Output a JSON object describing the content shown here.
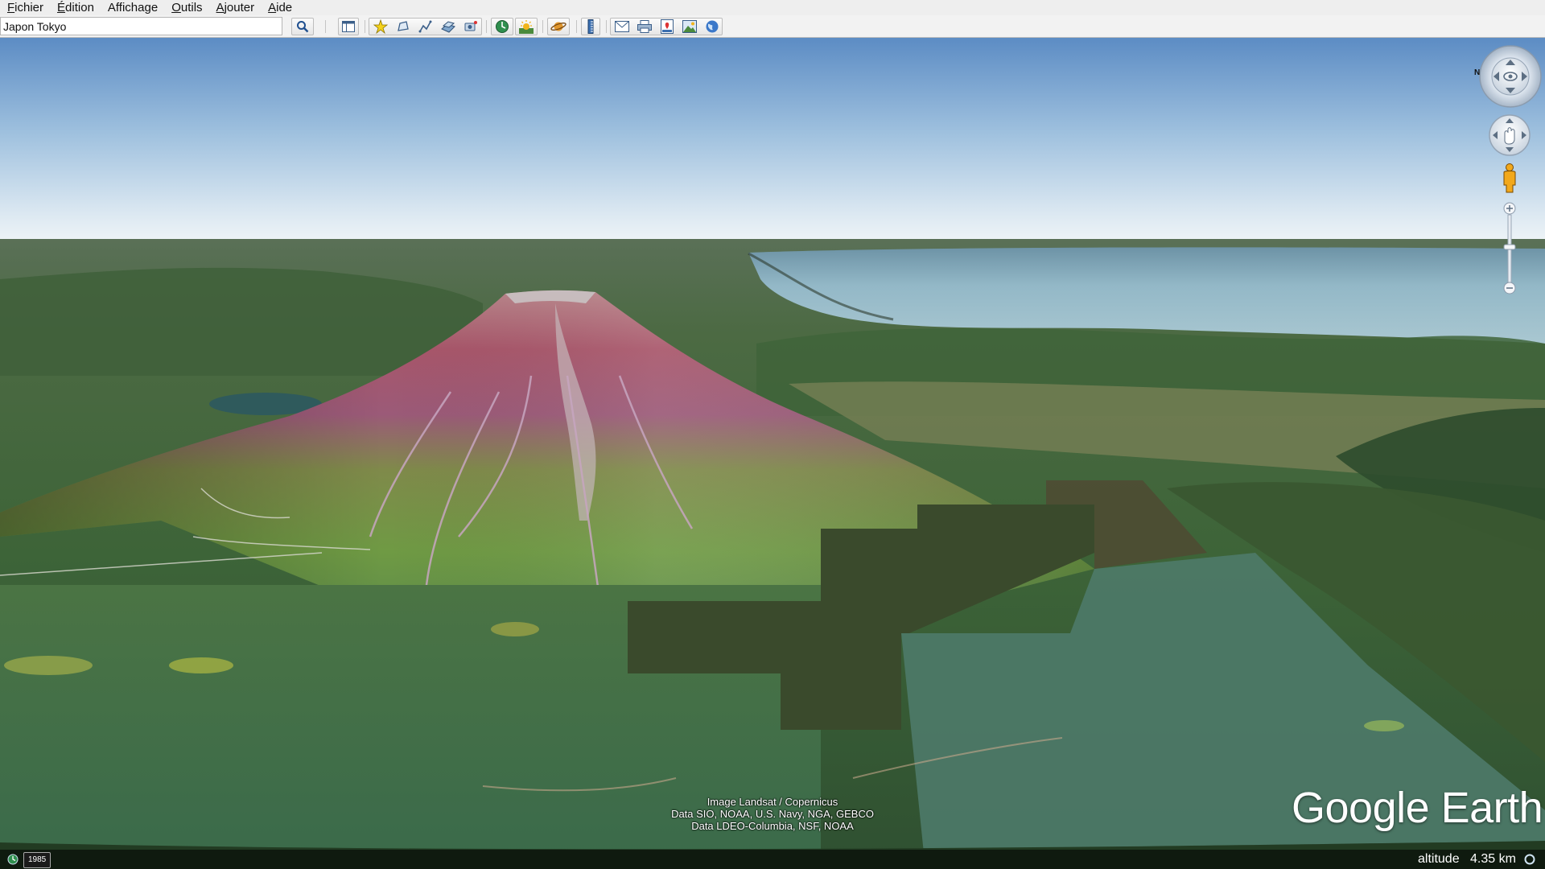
{
  "menubar": {
    "items": [
      {
        "mnemonic": "F",
        "rest": "ichier"
      },
      {
        "mnemonic": "É",
        "rest": "dition"
      },
      {
        "mnemonic": "",
        "rest": "Affichage"
      },
      {
        "mnemonic": "O",
        "rest": "utils"
      },
      {
        "mnemonic": "A",
        "rest": "jouter"
      },
      {
        "mnemonic": "A",
        "rest": "ide"
      }
    ]
  },
  "search": {
    "value": "Japon Tokyo"
  },
  "toolbar": {
    "icons": [
      "search-icon",
      "sidebar-toggle-icon",
      "placemark-icon",
      "polygon-icon",
      "path-icon",
      "image-overlay-icon",
      "record-tour-icon",
      "historical-imagery-icon",
      "sunlight-icon",
      "planets-icon",
      "ruler-icon",
      "email-icon",
      "print-icon",
      "save-image-icon",
      "view-in-maps-icon",
      "earth-gallery-icon"
    ]
  },
  "view": {
    "attribution": [
      "Image Landsat / Copernicus",
      "Data SIO, NOAA, U.S. Navy, NGA, GEBCO",
      "Data LDEO-Columbia, NSF, NOAA"
    ],
    "logo": "Google Earth",
    "year_badge": "1985",
    "altitude_label": "altitude",
    "altitude_value": "4.35 km",
    "compass_north": "N"
  },
  "colors": {
    "sky_top": "#5f8fc6",
    "sky_horizon": "#eef4f8",
    "forest": "#3e6a3a",
    "volcano_summit": "#b06a78",
    "sea": "#8fb5c4"
  }
}
